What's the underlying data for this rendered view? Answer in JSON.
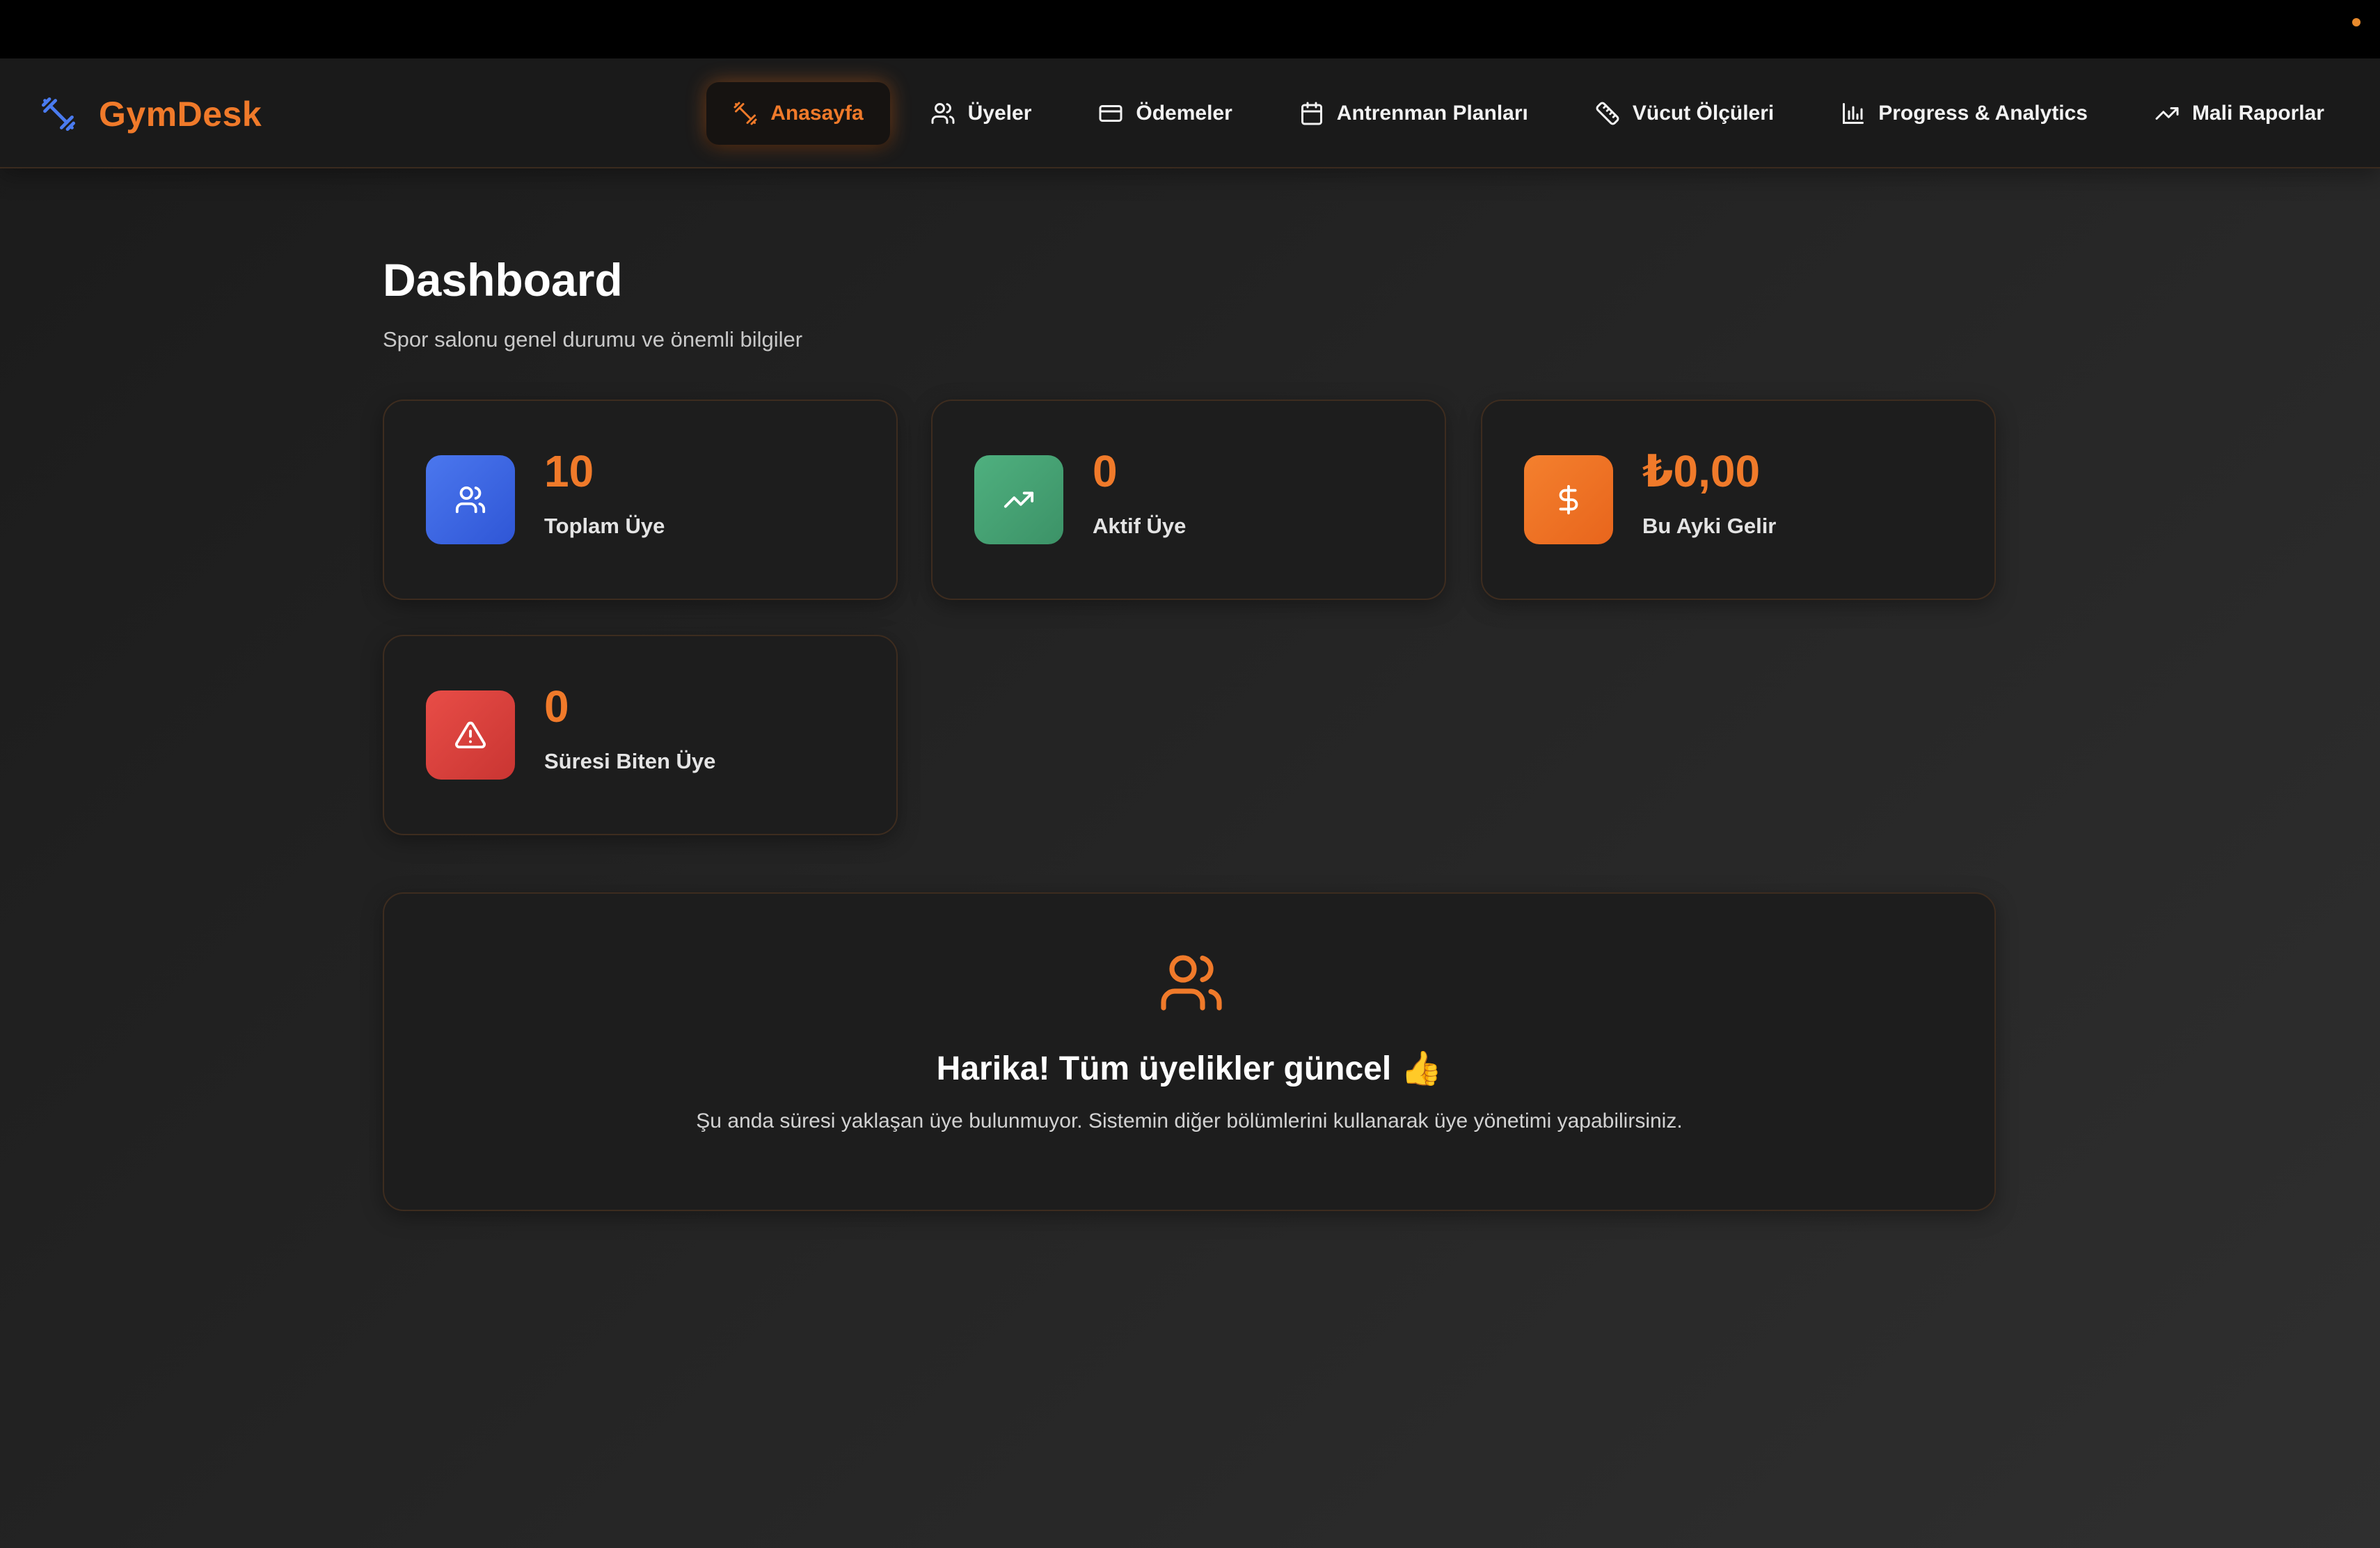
{
  "app": {
    "name": "GymDesk",
    "logo_icon": "dumbbell-icon"
  },
  "colors": {
    "accent": "#f07a2a",
    "background": "#1b1b1b",
    "card": "#1d1d1d"
  },
  "nav": {
    "items": [
      {
        "label": "Anasayfa",
        "icon": "dumbbell-icon",
        "active": true
      },
      {
        "label": "Üyeler",
        "icon": "users-icon",
        "active": false
      },
      {
        "label": "Ödemeler",
        "icon": "credit-card-icon",
        "active": false
      },
      {
        "label": "Antrenman Planları",
        "icon": "calendar-icon",
        "active": false
      },
      {
        "label": "Vücut Ölçüleri",
        "icon": "ruler-icon",
        "active": false
      },
      {
        "label": "Progress & Analytics",
        "icon": "bar-chart-icon",
        "active": false
      },
      {
        "label": "Mali Raporlar",
        "icon": "trending-up-icon",
        "active": false
      }
    ]
  },
  "page": {
    "title": "Dashboard",
    "subtitle": "Spor salonu genel durumu ve önemli bilgiler"
  },
  "stats": [
    {
      "value": "10",
      "label": "Toplam Üye",
      "icon": "users-icon",
      "color": "#3f66e2"
    },
    {
      "value": "0",
      "label": "Aktif Üye",
      "icon": "trending-up-icon",
      "color": "#46a173"
    },
    {
      "value": "₺0,00",
      "label": "Bu Ayki Gelir",
      "icon": "dollar-icon",
      "color": "#ef7326"
    },
    {
      "value": "0",
      "label": "Süresi Biten Üye",
      "icon": "warning-icon",
      "color": "#de423d"
    }
  ],
  "notice": {
    "icon": "users-icon",
    "title": "Harika! Tüm üyelikler güncel 👍",
    "description": "Şu anda süresi yaklaşan üye bulunmuyor. Sistemin diğer bölümlerini kullanarak üye yönetimi yapabilirsiniz."
  }
}
